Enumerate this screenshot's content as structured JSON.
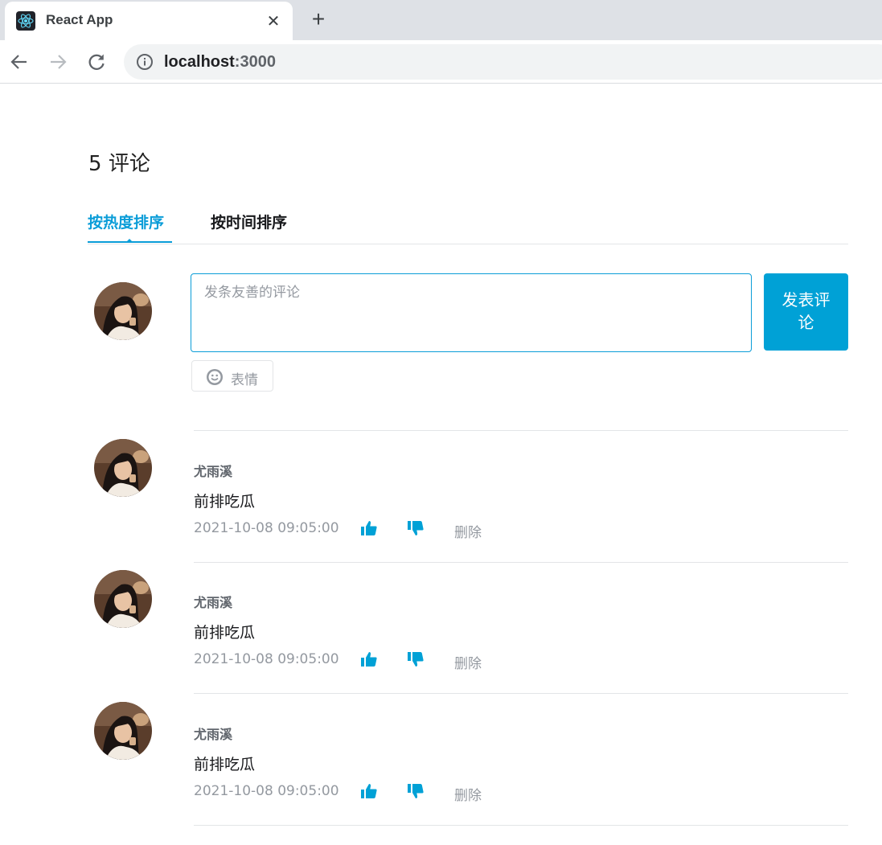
{
  "browser": {
    "tab_title": "React App",
    "close_glyph": "✕",
    "new_tab_glyph": "+",
    "url_host": "localhost",
    "url_port": ":3000",
    "icons": {
      "favicon": "react-logo-icon",
      "back": "arrow-left-icon",
      "forward": "arrow-right-icon",
      "reload": "reload-icon",
      "site_info": "info-icon"
    }
  },
  "header": {
    "count": "5",
    "count_label": "评论"
  },
  "sort_tabs": [
    {
      "label": "按热度排序",
      "active": true
    },
    {
      "label": "按时间排序",
      "active": false
    }
  ],
  "composer": {
    "placeholder": "发条友善的评论",
    "send_label": "发表评论",
    "emoji_label": "表情"
  },
  "comments": [
    {
      "user": "尤雨溪",
      "text": "前排吃瓜",
      "time": "2021-10-08 09:05:00",
      "delete_label": "删除"
    },
    {
      "user": "尤雨溪",
      "text": "前排吃瓜",
      "time": "2021-10-08 09:05:00",
      "delete_label": "删除"
    },
    {
      "user": "尤雨溪",
      "text": "前排吃瓜",
      "time": "2021-10-08 09:05:00",
      "delete_label": "删除"
    }
  ],
  "colors": {
    "accent": "#00a1d6",
    "accent_text": "#0b9dd8",
    "muted": "#9499a0",
    "divider": "#e3e5e7"
  }
}
